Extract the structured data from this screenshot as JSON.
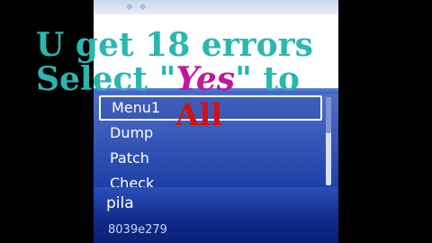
{
  "menu": {
    "items": [
      {
        "label": "Menu1"
      },
      {
        "label": "Dump"
      },
      {
        "label": "Patch"
      },
      {
        "label": "Check"
      }
    ]
  },
  "softkeys": {
    "left_label": "pila",
    "hex_value": "8039e279"
  },
  "caption": {
    "line1": "U get 18 errors",
    "line2_before": "Select \"",
    "line2_yes": "Yes",
    "line2_after": "\" to",
    "overlay": "All"
  },
  "colors": {
    "caption": "#2bb7b0",
    "yes": "#c0189a",
    "overlay": "#d41010",
    "menu_bg": "#2f57c2"
  }
}
